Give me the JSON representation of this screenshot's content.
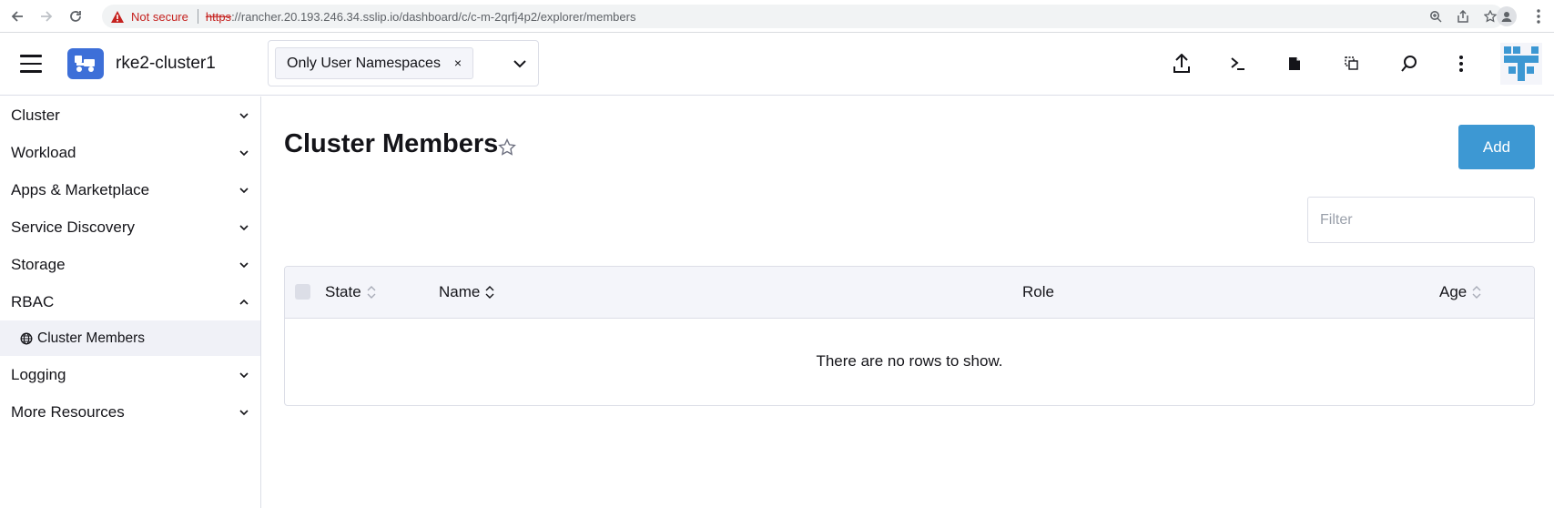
{
  "browser": {
    "security_label": "Not secure",
    "url_scheme": "https",
    "url_rest": "://rancher.20.193.246.34.sslip.io/dashboard/c/c-m-2qrfj4p2/explorer/members"
  },
  "header": {
    "cluster_name": "rke2-cluster1",
    "namespace_filter": "Only User Namespaces",
    "namespace_chip_close": "×",
    "icons": [
      "import-yaml-icon",
      "kubectl-shell-icon",
      "kubeconfig-file-icon",
      "copy-kubeconfig-icon",
      "search-icon",
      "more-options-icon"
    ]
  },
  "sidebar": {
    "groups": [
      {
        "label": "Cluster",
        "expanded": false
      },
      {
        "label": "Workload",
        "expanded": false
      },
      {
        "label": "Apps & Marketplace",
        "expanded": false
      },
      {
        "label": "Service Discovery",
        "expanded": false
      },
      {
        "label": "Storage",
        "expanded": false
      },
      {
        "label": "RBAC",
        "expanded": true
      },
      {
        "label": "Logging",
        "expanded": false
      },
      {
        "label": "More Resources",
        "expanded": false
      }
    ],
    "rbac_children": [
      {
        "label": "Cluster Members",
        "active": true
      }
    ]
  },
  "main": {
    "title": "Cluster Members",
    "add_label": "Add",
    "filter_placeholder": "Filter",
    "table": {
      "columns": [
        "State",
        "Name",
        "Role",
        "Age"
      ],
      "empty_message": "There are no rows to show."
    }
  },
  "colors": {
    "accent": "#3d98d3",
    "cluster_logo": "#3d6fd8",
    "active_item_bg": "#f0f1f7",
    "not_secure": "#c5221f"
  }
}
